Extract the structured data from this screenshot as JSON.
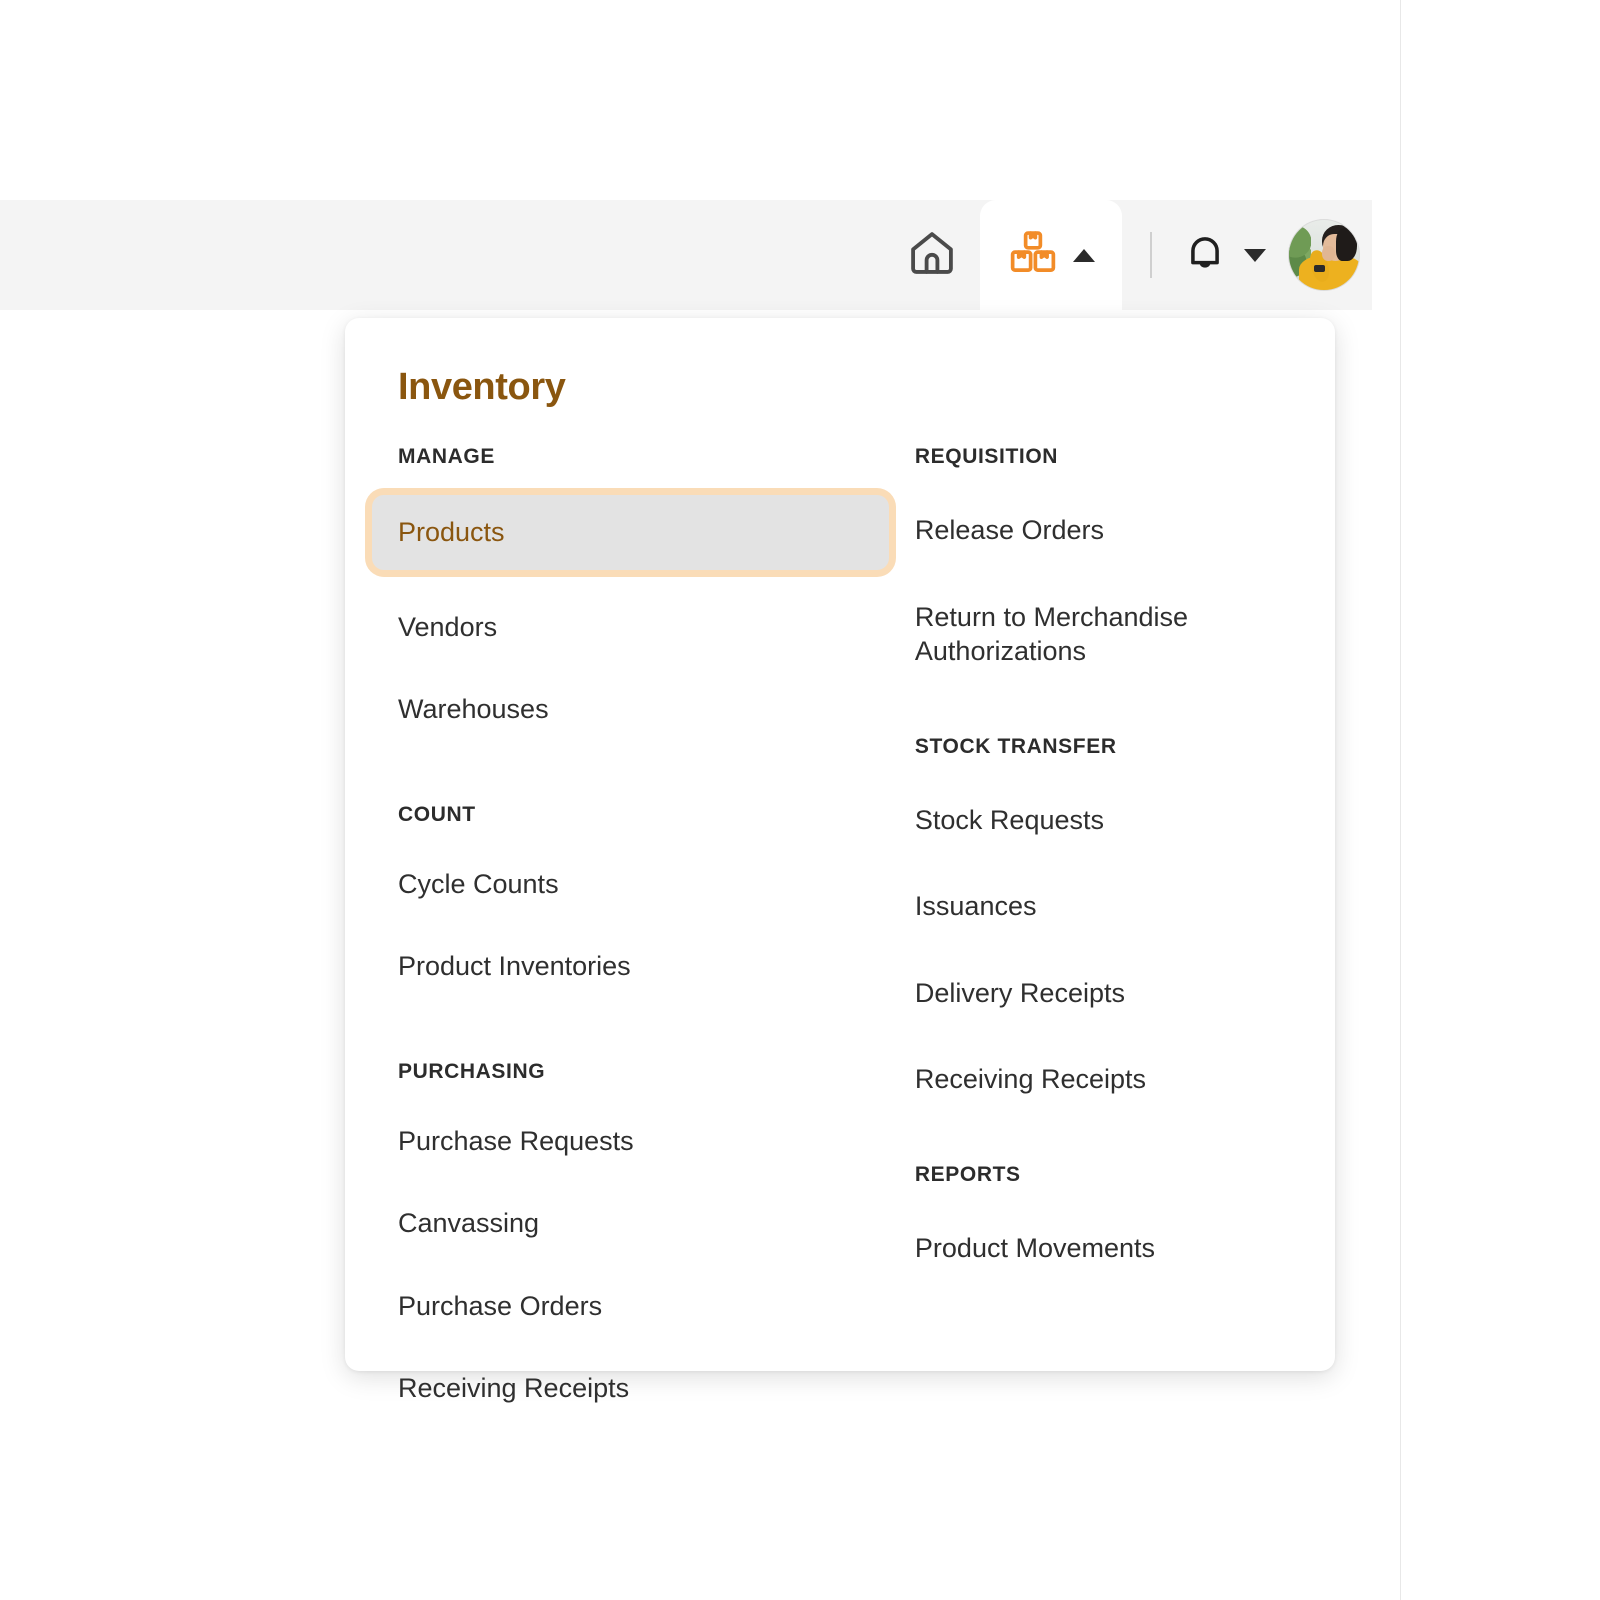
{
  "header": {
    "icons": {
      "home": "home-icon",
      "boxes": "boxes-icon",
      "bell": "bell-icon",
      "caret_up": "caret-up-icon",
      "caret_down": "caret-down-icon",
      "avatar": "user-avatar"
    },
    "active_tab": "Inventory",
    "colors": {
      "bar_bg": "#F4F4F4",
      "active_tab_bg": "#FFFFFF",
      "brand_orange": "#F28C28",
      "icon_dark": "#3A3A3A"
    }
  },
  "menu": {
    "title": "Inventory",
    "colors": {
      "title": "#8A560F",
      "active_item_bg": "#E3E3E3",
      "active_item_ring": "#FADCB7",
      "item_text": "#2F2F2F"
    },
    "left_groups": [
      {
        "heading": "MANAGE",
        "items": [
          {
            "label": "Products",
            "active": true
          },
          {
            "label": "Vendors",
            "active": false
          },
          {
            "label": "Warehouses",
            "active": false
          }
        ]
      },
      {
        "heading": "COUNT",
        "items": [
          {
            "label": "Cycle Counts",
            "active": false
          },
          {
            "label": "Product Inventories",
            "active": false
          }
        ]
      },
      {
        "heading": "PURCHASING",
        "items": [
          {
            "label": "Purchase Requests",
            "active": false
          },
          {
            "label": "Canvassing",
            "active": false
          },
          {
            "label": "Purchase Orders",
            "active": false
          },
          {
            "label": "Receiving Receipts",
            "active": false
          }
        ]
      }
    ],
    "right_groups": [
      {
        "heading": "REQUISITION",
        "items": [
          {
            "label": "Release Orders",
            "active": false
          },
          {
            "label": "Return to Merchandise Authorizations",
            "active": false
          }
        ]
      },
      {
        "heading": "STOCK TRANSFER",
        "items": [
          {
            "label": "Stock Requests",
            "active": false
          },
          {
            "label": "Issuances",
            "active": false
          },
          {
            "label": "Delivery Receipts",
            "active": false
          },
          {
            "label": "Receiving Receipts",
            "active": false
          }
        ]
      },
      {
        "heading": "REPORTS",
        "items": [
          {
            "label": "Product Movements",
            "active": false
          }
        ]
      }
    ]
  }
}
